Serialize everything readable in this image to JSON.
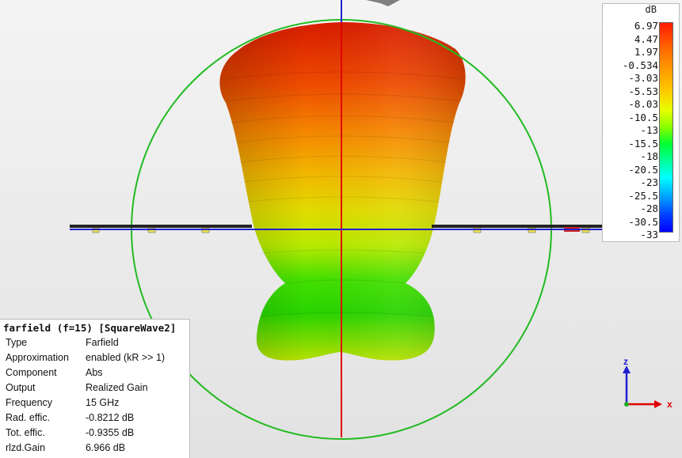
{
  "colorbar": {
    "unit": "dB",
    "ticks": [
      "6.97",
      "4.47",
      "1.97",
      "-0.534",
      "-3.03",
      "-5.53",
      "-8.03",
      "-10.5",
      "-13",
      "-15.5",
      "-18",
      "-20.5",
      "-23",
      "-25.5",
      "-28",
      "-30.5",
      "-33"
    ]
  },
  "info": {
    "title": "farfield (f=15) [SquareWave2]",
    "rows": [
      {
        "key": "Type",
        "value": "Farfield"
      },
      {
        "key": "Approximation",
        "value": "enabled (kR >> 1)"
      },
      {
        "key": "Component",
        "value": "Abs"
      },
      {
        "key": "Output",
        "value": "Realized Gain"
      },
      {
        "key": "Frequency",
        "value": "15 GHz"
      },
      {
        "key": "Rad. effic.",
        "value": "-0.8212 dB"
      },
      {
        "key": "Tot. effic.",
        "value": "-0.9355 dB"
      },
      {
        "key": "rlzd.Gain",
        "value": "6.966 dB"
      }
    ]
  },
  "axes": {
    "z_label": "z",
    "x_label": "x"
  },
  "colors": {
    "circle": "#22bb22",
    "z_axis": "#e00000",
    "horizontal_axis": "#1f1fd0",
    "axis_arrow_blue": "#1f1fd0",
    "axis_arrow_red": "#e00000"
  }
}
